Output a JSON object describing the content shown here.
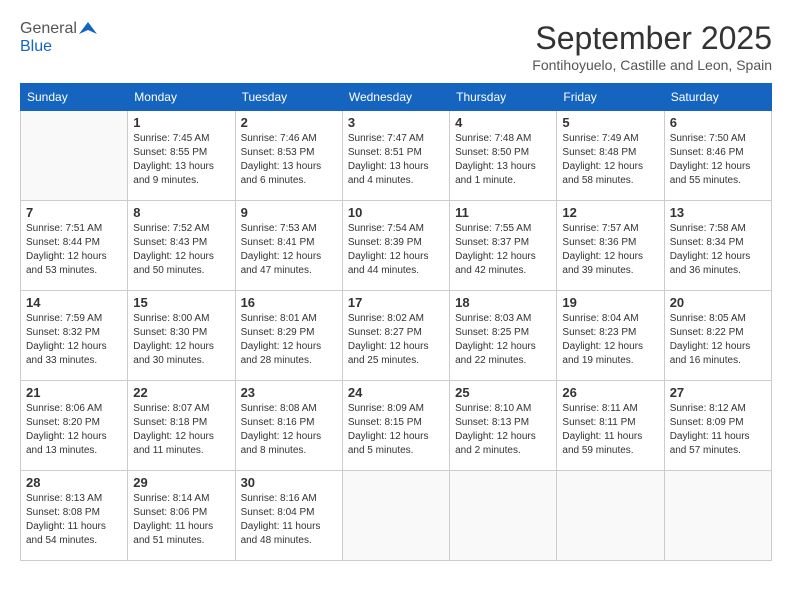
{
  "logo": {
    "general": "General",
    "blue": "Blue"
  },
  "title": "September 2025",
  "location": "Fontihoyuelo, Castille and Leon, Spain",
  "headers": [
    "Sunday",
    "Monday",
    "Tuesday",
    "Wednesday",
    "Thursday",
    "Friday",
    "Saturday"
  ],
  "weeks": [
    [
      {
        "day": "",
        "info": ""
      },
      {
        "day": "1",
        "info": "Sunrise: 7:45 AM\nSunset: 8:55 PM\nDaylight: 13 hours\nand 9 minutes."
      },
      {
        "day": "2",
        "info": "Sunrise: 7:46 AM\nSunset: 8:53 PM\nDaylight: 13 hours\nand 6 minutes."
      },
      {
        "day": "3",
        "info": "Sunrise: 7:47 AM\nSunset: 8:51 PM\nDaylight: 13 hours\nand 4 minutes."
      },
      {
        "day": "4",
        "info": "Sunrise: 7:48 AM\nSunset: 8:50 PM\nDaylight: 13 hours\nand 1 minute."
      },
      {
        "day": "5",
        "info": "Sunrise: 7:49 AM\nSunset: 8:48 PM\nDaylight: 12 hours\nand 58 minutes."
      },
      {
        "day": "6",
        "info": "Sunrise: 7:50 AM\nSunset: 8:46 PM\nDaylight: 12 hours\nand 55 minutes."
      }
    ],
    [
      {
        "day": "7",
        "info": "Sunrise: 7:51 AM\nSunset: 8:44 PM\nDaylight: 12 hours\nand 53 minutes."
      },
      {
        "day": "8",
        "info": "Sunrise: 7:52 AM\nSunset: 8:43 PM\nDaylight: 12 hours\nand 50 minutes."
      },
      {
        "day": "9",
        "info": "Sunrise: 7:53 AM\nSunset: 8:41 PM\nDaylight: 12 hours\nand 47 minutes."
      },
      {
        "day": "10",
        "info": "Sunrise: 7:54 AM\nSunset: 8:39 PM\nDaylight: 12 hours\nand 44 minutes."
      },
      {
        "day": "11",
        "info": "Sunrise: 7:55 AM\nSunset: 8:37 PM\nDaylight: 12 hours\nand 42 minutes."
      },
      {
        "day": "12",
        "info": "Sunrise: 7:57 AM\nSunset: 8:36 PM\nDaylight: 12 hours\nand 39 minutes."
      },
      {
        "day": "13",
        "info": "Sunrise: 7:58 AM\nSunset: 8:34 PM\nDaylight: 12 hours\nand 36 minutes."
      }
    ],
    [
      {
        "day": "14",
        "info": "Sunrise: 7:59 AM\nSunset: 8:32 PM\nDaylight: 12 hours\nand 33 minutes."
      },
      {
        "day": "15",
        "info": "Sunrise: 8:00 AM\nSunset: 8:30 PM\nDaylight: 12 hours\nand 30 minutes."
      },
      {
        "day": "16",
        "info": "Sunrise: 8:01 AM\nSunset: 8:29 PM\nDaylight: 12 hours\nand 28 minutes."
      },
      {
        "day": "17",
        "info": "Sunrise: 8:02 AM\nSunset: 8:27 PM\nDaylight: 12 hours\nand 25 minutes."
      },
      {
        "day": "18",
        "info": "Sunrise: 8:03 AM\nSunset: 8:25 PM\nDaylight: 12 hours\nand 22 minutes."
      },
      {
        "day": "19",
        "info": "Sunrise: 8:04 AM\nSunset: 8:23 PM\nDaylight: 12 hours\nand 19 minutes."
      },
      {
        "day": "20",
        "info": "Sunrise: 8:05 AM\nSunset: 8:22 PM\nDaylight: 12 hours\nand 16 minutes."
      }
    ],
    [
      {
        "day": "21",
        "info": "Sunrise: 8:06 AM\nSunset: 8:20 PM\nDaylight: 12 hours\nand 13 minutes."
      },
      {
        "day": "22",
        "info": "Sunrise: 8:07 AM\nSunset: 8:18 PM\nDaylight: 12 hours\nand 11 minutes."
      },
      {
        "day": "23",
        "info": "Sunrise: 8:08 AM\nSunset: 8:16 PM\nDaylight: 12 hours\nand 8 minutes."
      },
      {
        "day": "24",
        "info": "Sunrise: 8:09 AM\nSunset: 8:15 PM\nDaylight: 12 hours\nand 5 minutes."
      },
      {
        "day": "25",
        "info": "Sunrise: 8:10 AM\nSunset: 8:13 PM\nDaylight: 12 hours\nand 2 minutes."
      },
      {
        "day": "26",
        "info": "Sunrise: 8:11 AM\nSunset: 8:11 PM\nDaylight: 11 hours\nand 59 minutes."
      },
      {
        "day": "27",
        "info": "Sunrise: 8:12 AM\nSunset: 8:09 PM\nDaylight: 11 hours\nand 57 minutes."
      }
    ],
    [
      {
        "day": "28",
        "info": "Sunrise: 8:13 AM\nSunset: 8:08 PM\nDaylight: 11 hours\nand 54 minutes."
      },
      {
        "day": "29",
        "info": "Sunrise: 8:14 AM\nSunset: 8:06 PM\nDaylight: 11 hours\nand 51 minutes."
      },
      {
        "day": "30",
        "info": "Sunrise: 8:16 AM\nSunset: 8:04 PM\nDaylight: 11 hours\nand 48 minutes."
      },
      {
        "day": "",
        "info": ""
      },
      {
        "day": "",
        "info": ""
      },
      {
        "day": "",
        "info": ""
      },
      {
        "day": "",
        "info": ""
      }
    ]
  ]
}
